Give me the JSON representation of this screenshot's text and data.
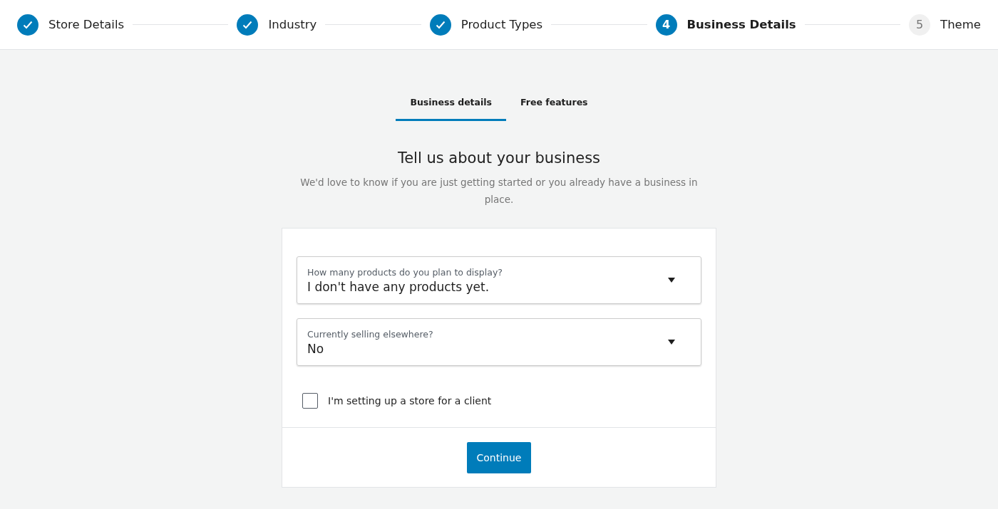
{
  "steps": [
    {
      "label": "Store Details",
      "completed": true,
      "selected": false
    },
    {
      "label": "Industry",
      "completed": true,
      "selected": false
    },
    {
      "label": "Product Types",
      "completed": true,
      "selected": false
    },
    {
      "label": "Business Details",
      "number": "4",
      "completed": false,
      "selected": true
    },
    {
      "label": "Theme",
      "number": "5",
      "completed": false,
      "selected": false
    }
  ],
  "tabs": [
    {
      "label": "Business details",
      "selected": true
    },
    {
      "label": "Free features",
      "selected": false
    }
  ],
  "heading": "Tell us about your business",
  "subtitle": "We'd love to know if you are just getting started or you already have a business in place.",
  "fields": [
    {
      "label": "How many products do you plan to display?",
      "value": "I don't have any products yet."
    },
    {
      "label": "Currently selling elsewhere?",
      "value": "No"
    }
  ],
  "checkbox": {
    "label": "I'm setting up a store for a client",
    "checked": false
  },
  "button": "Continue"
}
